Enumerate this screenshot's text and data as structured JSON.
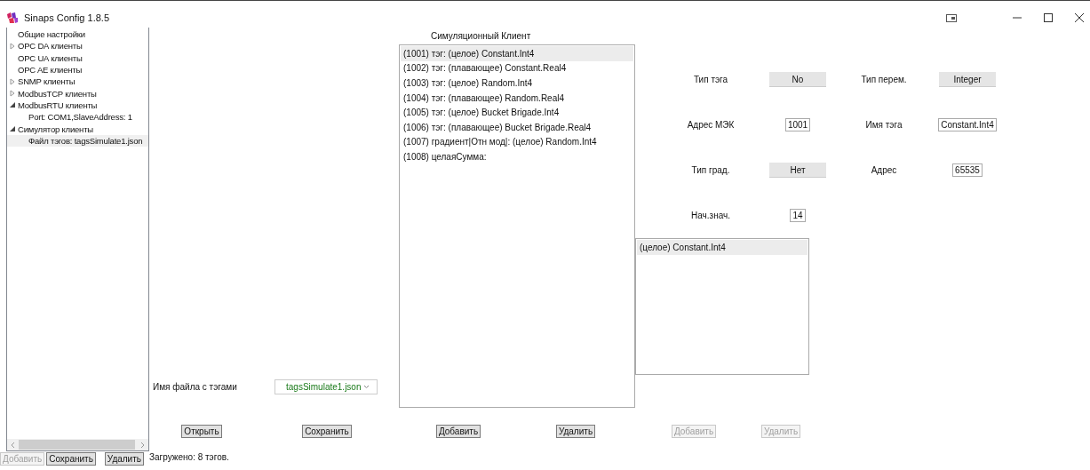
{
  "window": {
    "title": "Sinaps Config 1.8.5"
  },
  "tree": {
    "items": [
      {
        "label": "Общие настройки",
        "selected": false
      },
      {
        "label": "OPC DA клиенты",
        "expanded": false,
        "selected": false
      },
      {
        "label": "OPC UA клиенты",
        "selected": false
      },
      {
        "label": "OPC AE клиенты",
        "selected": false
      },
      {
        "label": "SNMP клиенты",
        "expanded": false,
        "selected": false
      },
      {
        "label": "ModbusTCP клиенты",
        "expanded": false,
        "selected": false
      },
      {
        "label": "ModbusRTU клиенты",
        "expanded": true,
        "selected": false,
        "children": [
          {
            "label": "Port: COM1,SlaveAddress: 1",
            "selected": false
          }
        ]
      },
      {
        "label": "Симулятор клиенты",
        "expanded": true,
        "selected": false,
        "children": [
          {
            "label": "Файл тэгов: tagsSimulate1.json",
            "selected": true
          }
        ]
      }
    ]
  },
  "tree_buttons": [
    {
      "label": "Добавить",
      "disabled": true
    },
    {
      "label": "Сохранить",
      "disabled": false
    },
    {
      "label": "Удалить",
      "disabled": false
    }
  ],
  "status_bar": {
    "text": "Загружено: 8 тэгов."
  },
  "tag_list": {
    "title": "Симуляционный Клиент",
    "items": [
      {
        "label": "(1001) тэг: (целое) Constant.Int4",
        "selected": true
      },
      {
        "label": "(1002) тэг: (плавающее) Constant.Real4",
        "selected": false
      },
      {
        "label": "(1003) тэг: (целое) Random.Int4",
        "selected": false
      },
      {
        "label": "(1004) тэг: (плавающее) Random.Real4",
        "selected": false
      },
      {
        "label": "(1005) тэг: (целое) Bucket Brigade.Int4",
        "selected": false
      },
      {
        "label": "(1006) тэг: (плавающее) Bucket Brigade.Real4",
        "selected": false
      },
      {
        "label": "(1007) градиент|Отн мод|: (целое) Random.Int4",
        "selected": false
      },
      {
        "label": "(1008) целаяСумма:",
        "selected": false
      }
    ]
  },
  "fields": [
    {
      "label": "Тип тэга",
      "value": "No",
      "kind": "button"
    },
    {
      "label": "Тип перем.",
      "value": "Integer",
      "kind": "button"
    },
    {
      "label": "Адрес МЭК",
      "value": "1001",
      "kind": "input"
    },
    {
      "label": "Имя тэга",
      "value": "Constant.Int4",
      "kind": "input"
    },
    {
      "label": "Тип град.",
      "value": "Нет",
      "kind": "button"
    },
    {
      "label": "Адрес",
      "value": "65535",
      "kind": "input"
    },
    {
      "label": "Нач.знач.",
      "value": "14",
      "kind": "input"
    }
  ],
  "sum_list": {
    "items": [
      {
        "label": "(целое) Constant.Int4",
        "selected": true
      }
    ]
  },
  "file": {
    "label": "Имя файла с тэгами",
    "value": "tagsSimulate1.json"
  },
  "buttons": [
    {
      "label": "Открыть",
      "disabled": false
    },
    {
      "label": "Сохранить",
      "disabled": false
    },
    {
      "label": "Добавить",
      "disabled": false
    },
    {
      "label": "Удалить",
      "disabled": false
    },
    {
      "label": "Добавить",
      "disabled": true
    },
    {
      "label": "Удалить",
      "disabled": true
    }
  ]
}
